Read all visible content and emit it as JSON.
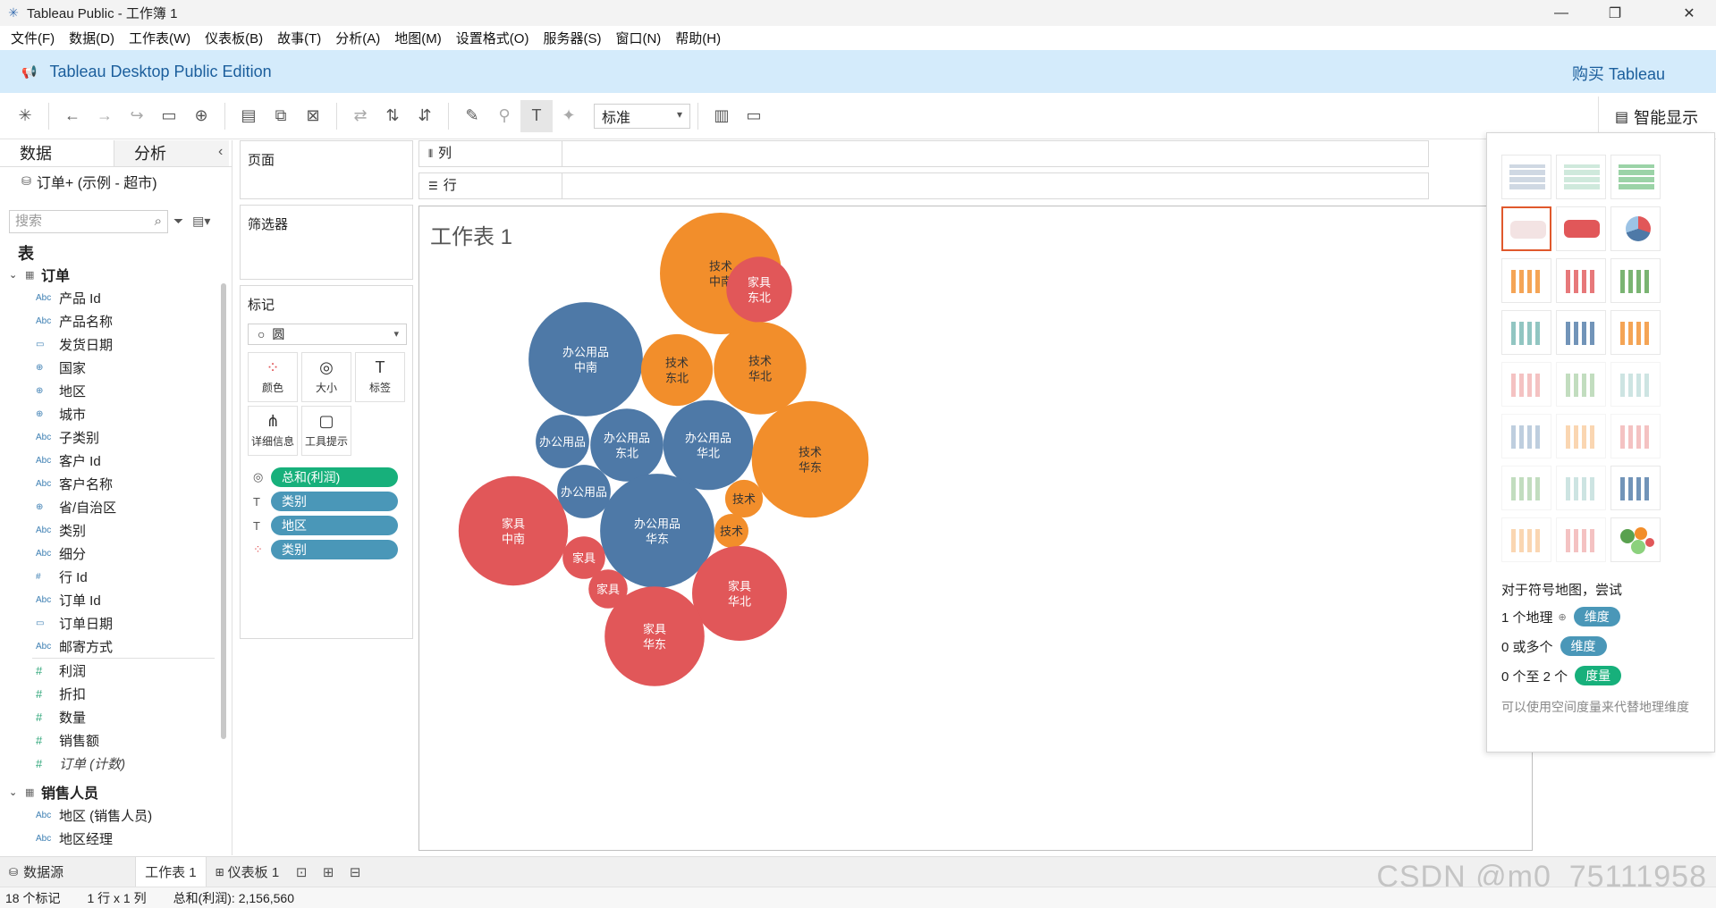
{
  "window": {
    "title": "Tableau Public - 工作簿 1",
    "controls": [
      "—",
      "❐",
      "✕"
    ]
  },
  "menu": [
    "文件(F)",
    "数据(D)",
    "工作表(W)",
    "仪表板(B)",
    "故事(T)",
    "分析(A)",
    "地图(M)",
    "设置格式(O)",
    "服务器(S)",
    "窗口(N)",
    "帮助(H)"
  ],
  "banner": {
    "edition": "Tableau Desktop Public Edition",
    "buy": "购买 Tableau"
  },
  "toolbar": {
    "fit_select": "标准",
    "show_me_label": "智能显示"
  },
  "data_pane": {
    "tabs": [
      "数据",
      "分析"
    ],
    "datasource": "订单+ (示例 - 超市)",
    "search_placeholder": "搜索",
    "section_label": "表",
    "groups": [
      {
        "name": "订单",
        "dimensions": [
          {
            "type": "Abc",
            "label": "产品 Id"
          },
          {
            "type": "Abc",
            "label": "产品名称"
          },
          {
            "type": "date",
            "label": "发货日期"
          },
          {
            "type": "geo",
            "label": "国家"
          },
          {
            "type": "geo",
            "label": "地区"
          },
          {
            "type": "geo",
            "label": "城市"
          },
          {
            "type": "Abc",
            "label": "子类别"
          },
          {
            "type": "Abc",
            "label": "客户 Id"
          },
          {
            "type": "Abc",
            "label": "客户名称"
          },
          {
            "type": "geo",
            "label": "省/自治区"
          },
          {
            "type": "Abc",
            "label": "类别"
          },
          {
            "type": "Abc",
            "label": "细分"
          },
          {
            "type": "#",
            "label": "行 Id"
          },
          {
            "type": "Abc",
            "label": "订单 Id"
          },
          {
            "type": "date",
            "label": "订单日期"
          },
          {
            "type": "Abc",
            "label": "邮寄方式"
          }
        ],
        "measures": [
          {
            "label": "利润"
          },
          {
            "label": "折扣"
          },
          {
            "label": "数量"
          },
          {
            "label": "销售额"
          },
          {
            "label": "订单 (计数)"
          }
        ]
      },
      {
        "name": "销售人员",
        "dimensions": [
          {
            "type": "Abc",
            "label": "地区 (销售人员)"
          },
          {
            "type": "Abc",
            "label": "地区经理"
          }
        ]
      }
    ]
  },
  "shelves": {
    "pages": "页面",
    "filters": "筛选器",
    "marks_title": "标记",
    "mark_type": "圆",
    "mark_buttons": [
      "颜色",
      "大小",
      "标签",
      "详细信息",
      "工具提示"
    ],
    "pills": [
      {
        "label": "总和(利润)",
        "color": "#17b07b",
        "icon": "size"
      },
      {
        "label": "类别",
        "color": "#4a97b8",
        "icon": "label"
      },
      {
        "label": "地区",
        "color": "#4a97b8",
        "icon": "label"
      },
      {
        "label": "类别",
        "color": "#4a97b8",
        "icon": "color"
      }
    ],
    "columns_label": "列",
    "rows_label": "行"
  },
  "sheet": {
    "title": "工作表 1"
  },
  "chart_data": {
    "type": "packed-bubble",
    "title": "工作表 1",
    "size_measure": "总和(利润)",
    "color_field": "类别",
    "colors": {
      "技术": "#f28e2b",
      "办公用品": "#4e79a7",
      "家具": "#e15759"
    },
    "bubbles": [
      {
        "category": "技术",
        "region": "中南",
        "label": "技术\n中南",
        "relative_size": 1.0
      },
      {
        "category": "家具",
        "region": "东北",
        "label": "家具\n东北",
        "relative_size": 0.54
      },
      {
        "category": "办公用品",
        "region": "中南",
        "label": "办公用品\n中南",
        "relative_size": 0.94
      },
      {
        "category": "技术",
        "region": "东北",
        "label": "技术\n东北",
        "relative_size": 0.59
      },
      {
        "category": "技术",
        "region": "华北",
        "label": "技术\n华北",
        "relative_size": 0.76
      },
      {
        "category": "办公用品",
        "region": "",
        "label": "办公用品",
        "relative_size": 0.44
      },
      {
        "category": "办公用品",
        "region": "东北",
        "label": "办公用品\n东北",
        "relative_size": 0.6
      },
      {
        "category": "办公用品",
        "region": "华北",
        "label": "办公用品\n华北",
        "relative_size": 0.74
      },
      {
        "category": "技术",
        "region": "华东",
        "label": "技术\n华东",
        "relative_size": 0.96
      },
      {
        "category": "办公用品",
        "region": "",
        "label": "办公用品",
        "relative_size": 0.44
      },
      {
        "category": "技术",
        "region": "",
        "label": "技术",
        "relative_size": 0.31
      },
      {
        "category": "家具",
        "region": "中南",
        "label": "家具\n中南",
        "relative_size": 0.9
      },
      {
        "category": "办公用品",
        "region": "华东",
        "label": "办公用品\n华东",
        "relative_size": 0.94
      },
      {
        "category": "技术",
        "region": "",
        "label": "技术",
        "relative_size": 0.28
      },
      {
        "category": "家具",
        "region": "",
        "label": "家具",
        "relative_size": 0.35
      },
      {
        "category": "家具",
        "region": "",
        "label": "家具",
        "relative_size": 0.32
      },
      {
        "category": "家具",
        "region": "华北",
        "label": "家具\n华北",
        "relative_size": 0.78
      },
      {
        "category": "家具",
        "region": "华东",
        "label": "家具\n华东",
        "relative_size": 0.82
      }
    ]
  },
  "show_me": {
    "hint_title": "对于符号地图，尝试",
    "hints": [
      {
        "prefix": "1 个地理",
        "pill": "维度",
        "color": "#4a97b8",
        "icon": "geo"
      },
      {
        "prefix": "0 或多个",
        "pill": "维度",
        "color": "#4a97b8",
        "icon": ""
      },
      {
        "prefix": "0 个至 2 个",
        "pill": "度量",
        "color": "#17b07b",
        "icon": ""
      }
    ],
    "note": "可以使用空间度量来代替地理维度"
  },
  "bottom_tabs": {
    "datasource": "数据源",
    "sheet": "工作表 1",
    "dashboard": "仪表板 1"
  },
  "status": {
    "marks": "18 个标记",
    "rows_cols": "1 行 x 1 列",
    "sum": "总和(利润): 2,156,560"
  },
  "watermark": "CSDN @m0_75111958"
}
